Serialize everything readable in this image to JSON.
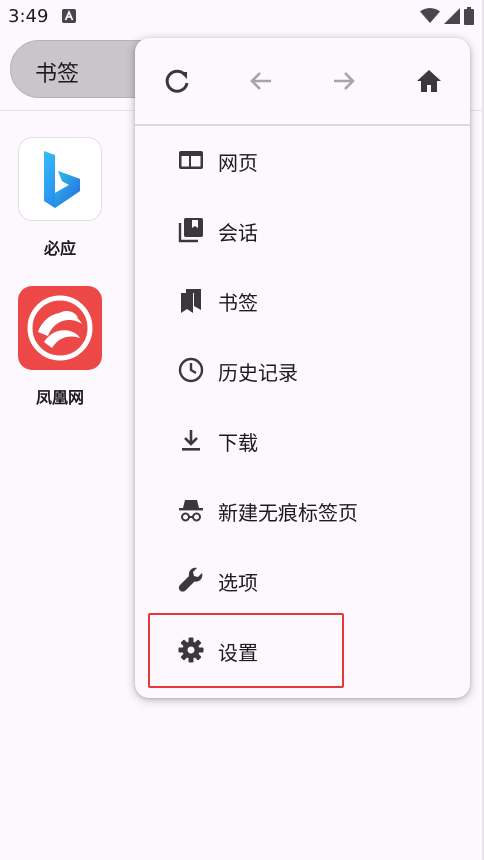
{
  "status_bar": {
    "time": "3:49"
  },
  "top_bar": {
    "url_text": "书签"
  },
  "shortcuts": [
    {
      "label": "必应",
      "icon": "bing-logo-icon",
      "tile_color": "#ffffff"
    },
    {
      "label": "凤凰网",
      "icon": "ifeng-logo-icon",
      "tile_color": "#ec4848"
    }
  ],
  "menu": {
    "toolbar": [
      {
        "name": "reload",
        "icon": "reload-icon"
      },
      {
        "name": "back",
        "icon": "arrow-back-icon"
      },
      {
        "name": "forward",
        "icon": "arrow-forward-icon"
      },
      {
        "name": "home",
        "icon": "home-icon"
      }
    ],
    "items": [
      {
        "label": "网页",
        "icon": "webpage-icon"
      },
      {
        "label": "会话",
        "icon": "sessions-icon"
      },
      {
        "label": "书签",
        "icon": "bookmarks-icon"
      },
      {
        "label": "历史记录",
        "icon": "history-icon"
      },
      {
        "label": "下载",
        "icon": "download-icon"
      },
      {
        "label": "新建无痕标签页",
        "icon": "incognito-icon"
      },
      {
        "label": "选项",
        "icon": "wrench-icon"
      },
      {
        "label": "设置",
        "icon": "gear-icon"
      }
    ]
  },
  "colors": {
    "highlight": "#e53935",
    "icon_dark": "#3a373d",
    "icon_disabled": "#a8a4ab"
  }
}
